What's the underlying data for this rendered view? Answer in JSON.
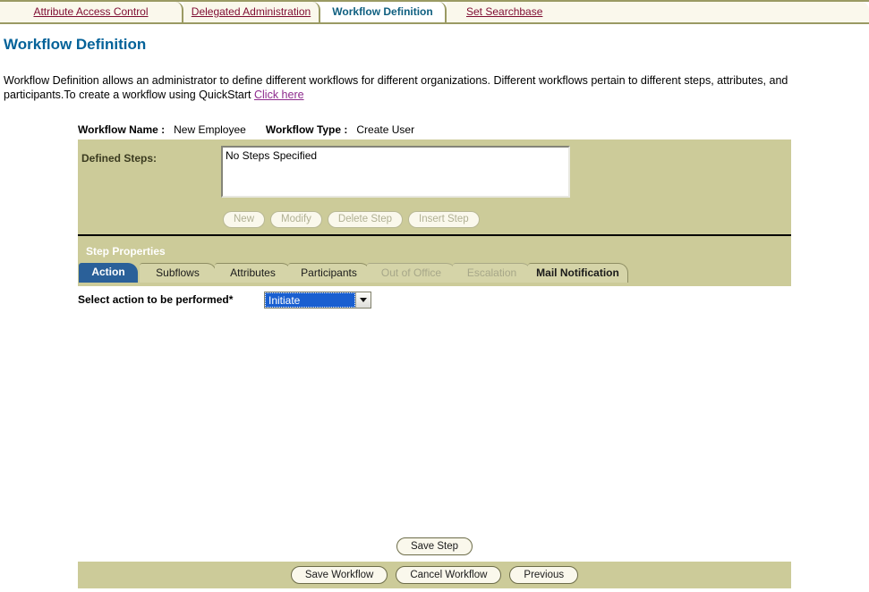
{
  "top_tabs": [
    {
      "label": "Attribute Access Control",
      "state": "inactive"
    },
    {
      "label": "Delegated Administration",
      "state": "inactive"
    },
    {
      "label": "Workflow Definition",
      "state": "active"
    },
    {
      "label": "Set Searchbase",
      "state": "inactive"
    }
  ],
  "page": {
    "title": "Workflow Definition",
    "intro_part1": "Workflow Definition allows an administrator to define different workflows for different organizations. Different workflows pertain to different steps, attributes, and participants.To create a workflow using QuickStart ",
    "intro_link": "Click here"
  },
  "meta": {
    "name_label": "Workflow Name :",
    "name_value": "New Employee",
    "type_label": "Workflow Type :",
    "type_value": "Create User"
  },
  "defined_steps": {
    "label": "Defined Steps:",
    "list_text": "No Steps Specified",
    "buttons": [
      {
        "label": "New",
        "disabled": true
      },
      {
        "label": "Modify",
        "disabled": true
      },
      {
        "label": "Delete Step",
        "disabled": true
      },
      {
        "label": "Insert Step",
        "disabled": true
      }
    ]
  },
  "step_properties": {
    "title": "Step Properties",
    "tabs": [
      {
        "label": "Action",
        "state": "active"
      },
      {
        "label": "Subflows",
        "state": "idle"
      },
      {
        "label": "Attributes",
        "state": "idle"
      },
      {
        "label": "Participants",
        "state": "idle"
      },
      {
        "label": "Out of Office",
        "state": "disabled"
      },
      {
        "label": "Escalation",
        "state": "disabled"
      },
      {
        "label": "Mail Notification",
        "state": "idle"
      }
    ]
  },
  "action": {
    "label": "Select action to be performed*",
    "selected_value": "Initiate",
    "options": [
      "Initiate"
    ]
  },
  "footer": {
    "save_step": "Save Step",
    "save_workflow": "Save Workflow",
    "cancel_workflow": "Cancel Workflow",
    "previous": "Previous"
  },
  "colors": {
    "panel_khaki": "#cccb99",
    "tab_active_blue": "#2a6099",
    "title_blue": "#046299",
    "link_red": "#7e0b31",
    "link_purple": "#8d2b8d",
    "toptab_active_text": "#0f5f80"
  }
}
